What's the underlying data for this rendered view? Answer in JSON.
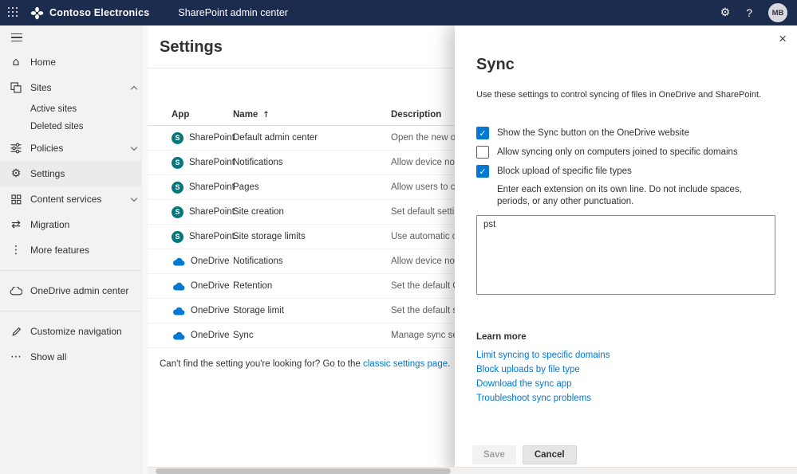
{
  "colors": {
    "topbar": "#1b2c4f",
    "accent": "#0078d4",
    "sharepoint": "#03787c",
    "sidebar-bg": "#f3f2f1"
  },
  "topbar": {
    "brand": "Contoso Electronics",
    "title": "SharePoint admin center",
    "help": "?",
    "avatar_initials": "MB"
  },
  "sidebar": {
    "items": [
      {
        "label": "Home"
      },
      {
        "label": "Sites"
      },
      {
        "label": "Active sites"
      },
      {
        "label": "Deleted sites"
      },
      {
        "label": "Policies"
      },
      {
        "label": "Settings"
      },
      {
        "label": "Content services"
      },
      {
        "label": "Migration"
      },
      {
        "label": "More features"
      },
      {
        "label": "OneDrive admin center"
      },
      {
        "label": "Customize navigation"
      },
      {
        "label": "Show all"
      }
    ]
  },
  "main": {
    "title": "Settings",
    "table": {
      "col_app": "App",
      "col_name": "Name",
      "sort_icon": "↑",
      "col_desc": "Description",
      "rows": [
        {
          "app": "SharePoint",
          "name": "Default admin center",
          "description": "Open the new or clas"
        },
        {
          "app": "SharePoint",
          "name": "Notifications",
          "description": "Allow device notificat"
        },
        {
          "app": "SharePoint",
          "name": "Pages",
          "description": "Allow users to create"
        },
        {
          "app": "SharePoint",
          "name": "Site creation",
          "description": "Set default settings f"
        },
        {
          "app": "SharePoint",
          "name": "Site storage limits",
          "description": "Use automatic or ma"
        },
        {
          "app": "OneDrive",
          "name": "Notifications",
          "description": "Allow device notificat"
        },
        {
          "app": "OneDrive",
          "name": "Retention",
          "description": "Set the default OneD"
        },
        {
          "app": "OneDrive",
          "name": "Storage limit",
          "description": "Set the default stora"
        },
        {
          "app": "OneDrive",
          "name": "Sync",
          "description": "Manage sync settings"
        }
      ]
    },
    "footer_prefix": "Can't find the setting you're looking for? Go to the ",
    "footer_link": "classic settings page",
    "footer_suffix": "."
  },
  "panel": {
    "title": "Sync",
    "description": "Use these settings to control syncing of files in OneDrive and SharePoint.",
    "checkboxes": [
      {
        "label": "Show the Sync button on the OneDrive website",
        "checked": true
      },
      {
        "label": "Allow syncing only on computers joined to specific domains",
        "checked": false
      },
      {
        "label": "Block upload of specific file types",
        "checked": true
      }
    ],
    "extensions_help": "Enter each extension on its own line. Do not include spaces, periods, or any other punctuation.",
    "extensions_value": "pst",
    "learn_more_title": "Learn more",
    "links": [
      {
        "label": "Limit syncing to specific domains"
      },
      {
        "label": "Block uploads by file type"
      },
      {
        "label": "Download the sync app"
      },
      {
        "label": "Troubleshoot sync problems"
      }
    ],
    "save_label": "Save",
    "cancel_label": "Cancel"
  }
}
